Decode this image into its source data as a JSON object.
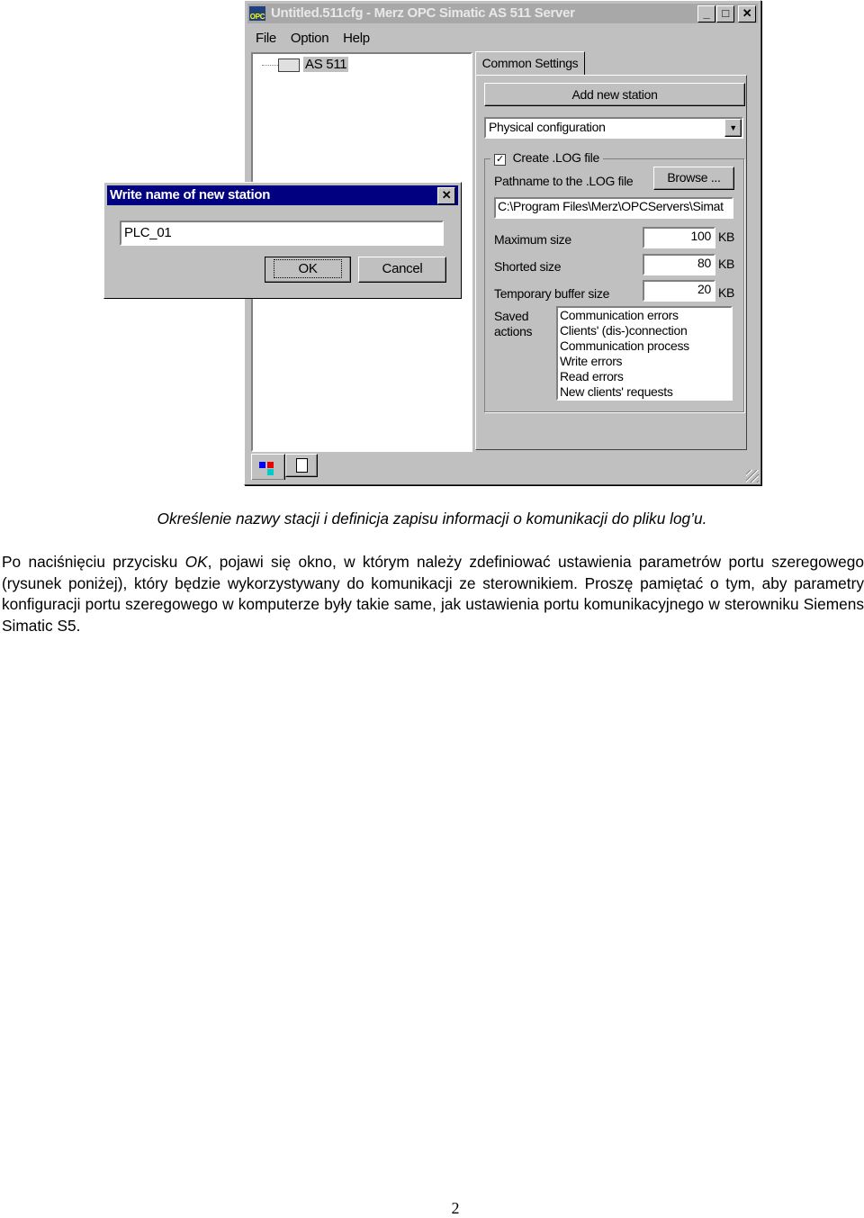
{
  "window": {
    "title": "Untitled.511cfg - Merz OPC Simatic AS 511 Server",
    "icon": "opc-app-icon",
    "menu": [
      "File",
      "Option",
      "Help"
    ],
    "tree": {
      "item": "AS 511"
    },
    "tab": "Common Settings",
    "add_station": "Add new station",
    "dropdown": {
      "value": "Physical configuration"
    },
    "log": {
      "checkbox_label": "Create .LOG file",
      "checked": true,
      "path_label": "Pathname to the .LOG file",
      "browse": "Browse ...",
      "path": "C:\\Program Files\\Merz\\OPCServers\\Simat",
      "max_label": "Maximum size",
      "max": "100",
      "shorted_label": "Shorted size",
      "shorted": "80",
      "temp_label": "Temporary buffer size",
      "temp": "20",
      "unit": "KB",
      "saved_label_1": "Saved",
      "saved_label_2": "actions",
      "actions": [
        "Communication errors",
        "Clients' (dis-)connection",
        "Communication process",
        "Write errors",
        "Read errors",
        "New clients' requests"
      ]
    }
  },
  "dialog": {
    "title": "Write name of new station",
    "value": "PLC_01",
    "ok": "OK",
    "cancel": "Cancel"
  },
  "caption": "Określenie nazwy stacji i definicja zapisu informacji o komunikacji do pliku log’u.",
  "paragraph": {
    "before": "Po naciśnięciu przycisku ",
    "ok": "OK",
    "after": ", pojawi się okno, w którym należy zdefiniować ustawienia parametrów portu szeregowego (rysunek poniżej), który będzie wykorzystywany do komunikacji ze sterownikiem. Proszę pamiętać o tym, aby parametry konfiguracji portu szeregowego w komputerze były takie same, jak ustawienia portu komunikacyjnego w sterowniku Siemens Simatic S5."
  },
  "page_number": "2"
}
